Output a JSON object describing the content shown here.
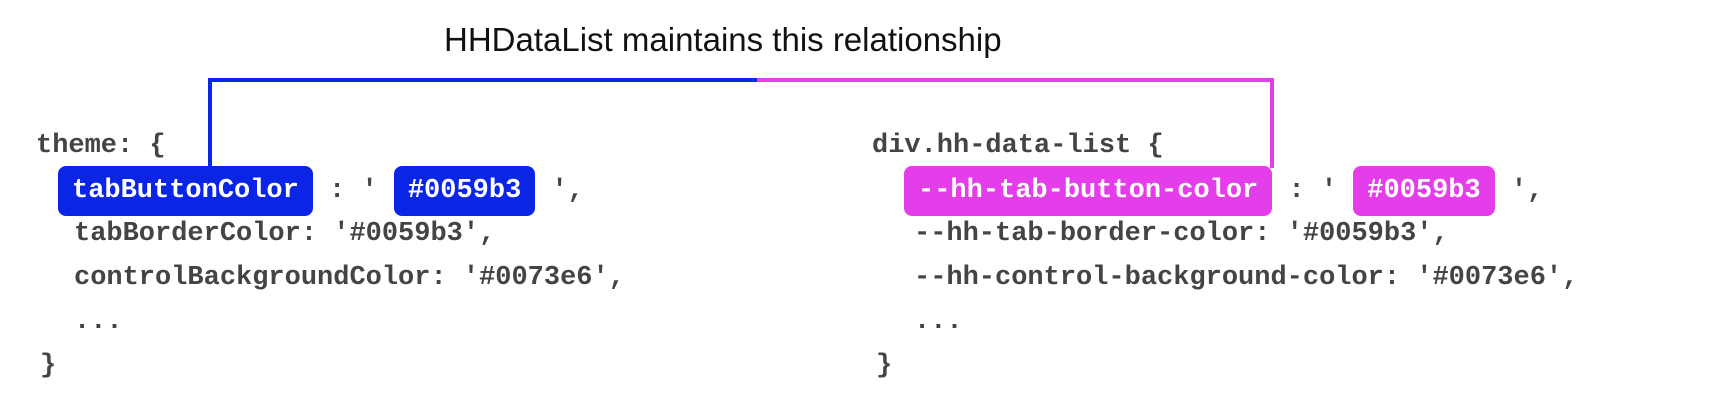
{
  "title": "HHDataList maintains this relationship",
  "colors": {
    "blue": "#0b25e6",
    "magenta": "#e33ee9",
    "code_text": "#444444"
  },
  "left_block": {
    "open": "theme: {",
    "highlight_key": "tabButtonColor",
    "sep": " : ' ",
    "highlight_value": "#0059b3",
    "end": " ',",
    "line2": "tabBorderColor: '#0059b3',",
    "line3": "controlBackgroundColor: '#0073e6',",
    "ellipsis": "...",
    "close": "}"
  },
  "right_block": {
    "open": "div.hh-data-list {",
    "highlight_key": "--hh-tab-button-color",
    "sep": " : ' ",
    "highlight_value": "#0059b3",
    "end": " ',",
    "line2": "--hh-tab-border-color: '#0059b3',",
    "line3": "--hh-control-background-color: '#0073e6',",
    "ellipsis": "...",
    "close": "}"
  }
}
